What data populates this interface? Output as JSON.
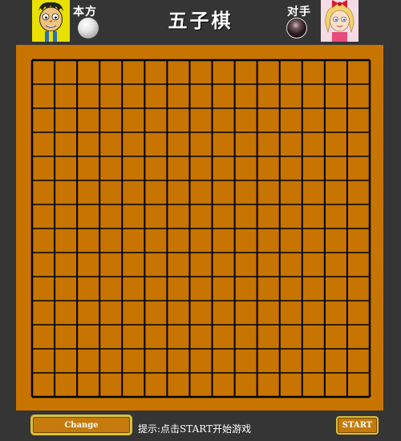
{
  "header": {
    "title": "五子棋",
    "self_label": "本方",
    "opponent_label": "对手",
    "self_avatar_icon": "boy-avatar-icon",
    "opponent_avatar_icon": "girl-avatar-icon",
    "self_stone": "white-stone-icon",
    "opponent_stone": "black-stone-icon"
  },
  "board": {
    "columns": 15,
    "rows": 14,
    "board_color": "#c77400",
    "line_color": "#000000",
    "stones": []
  },
  "footer": {
    "change_label": "Change",
    "hint": "提示:点击START开始游戏",
    "start_label": "START"
  },
  "colors": {
    "background": "#353535",
    "button_fill": "#c47a0c",
    "button_border": "#d8c23a"
  }
}
